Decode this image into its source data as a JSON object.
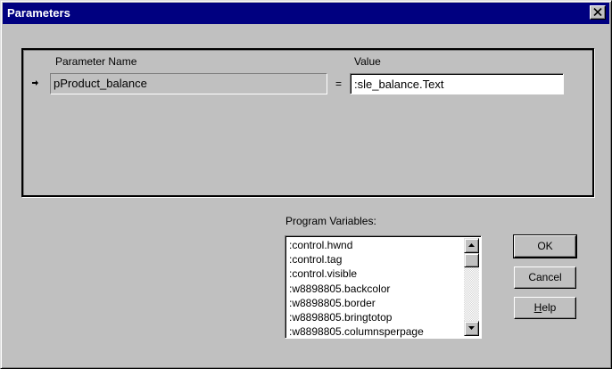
{
  "window": {
    "title": "Parameters"
  },
  "columns": {
    "name_label": "Parameter Name",
    "value_label": "Value"
  },
  "parameter": {
    "name": "pProduct_balance",
    "equals": "=",
    "value": ":sle_balance.Text"
  },
  "program_variables": {
    "label": "Program Variables:",
    "items": [
      ":control.hwnd",
      ":control.tag",
      ":control.visible",
      ":w8898805.backcolor",
      ":w8898805.border",
      ":w8898805.bringtotop",
      ":w8898805.columnsperpage"
    ]
  },
  "buttons": {
    "ok": "OK",
    "cancel": "Cancel",
    "help": "Help"
  },
  "icons": {
    "close": "close-icon",
    "row_indicator": "row-pointer-icon",
    "scroll_up": "arrow-up-icon",
    "scroll_down": "arrow-down-icon"
  }
}
